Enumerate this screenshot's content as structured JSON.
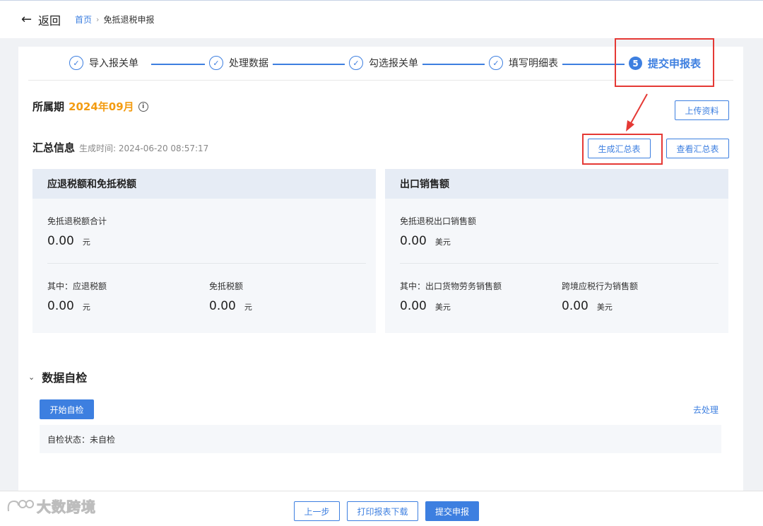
{
  "header": {
    "back_label": "返回",
    "breadcrumb_home": "首页",
    "breadcrumb_separator": "›",
    "breadcrumb_current": "免抵退税申报"
  },
  "steps": [
    {
      "label": "导入报关单",
      "status": "done"
    },
    {
      "label": "处理数据",
      "status": "done"
    },
    {
      "label": "勾选报关单",
      "status": "done"
    },
    {
      "label": "填写明细表",
      "status": "done"
    },
    {
      "label": "提交申报表",
      "status": "active",
      "number": "5"
    }
  ],
  "period": {
    "label": "所属期",
    "value": "2024年09月",
    "info_icon": "i"
  },
  "actions": {
    "upload": "上传资料",
    "generate": "生成汇总表",
    "view": "查看汇总表"
  },
  "summary": {
    "title": "汇总信息",
    "time": "生成时间: 2024-06-20 08:57:17"
  },
  "refund_panel": {
    "title": "应退税额和免抵税额",
    "total_label": "免抵退税额合计",
    "total_value": "0.00",
    "total_unit": "元",
    "refund_label": "其中：应退税额",
    "refund_value": "0.00",
    "refund_unit": "元",
    "exempt_label": "免抵税额",
    "exempt_value": "0.00",
    "exempt_unit": "元"
  },
  "sales_panel": {
    "title": "出口销售额",
    "total_label": "免抵退税出口销售额",
    "total_value": "0.00",
    "total_unit": "美元",
    "goods_label": "其中：出口货物劳务销售额",
    "goods_value": "0.00",
    "goods_unit": "美元",
    "cross_label": "跨境应税行为销售额",
    "cross_value": "0.00",
    "cross_unit": "美元"
  },
  "self_check": {
    "title": "数据自检",
    "start_button": "开始自检",
    "handle_link": "去处理",
    "status": "自检状态：未自检"
  },
  "footer": {
    "prev": "上一步",
    "print": "打印报表下载",
    "submit": "提交申报"
  },
  "watermark": {
    "text": "大数跨境"
  },
  "colors": {
    "accent": "#3d7fe0",
    "period": "#f39c12",
    "annotation": "#e53935"
  }
}
